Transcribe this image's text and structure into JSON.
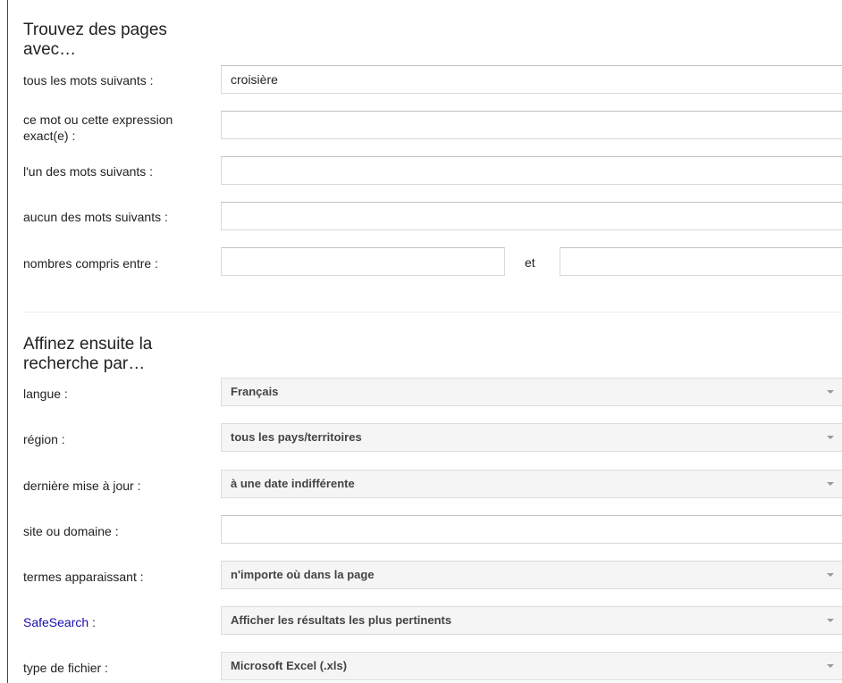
{
  "section1": {
    "heading": "Trouvez des pages avec…",
    "rows": [
      {
        "label": "tous les mots suivants :",
        "value": "croisière"
      },
      {
        "label": "ce mot ou cette expression exact(e) :",
        "value": ""
      },
      {
        "label": "l'un des mots suivants :",
        "value": ""
      },
      {
        "label": "aucun des mots suivants :",
        "value": ""
      },
      {
        "label": "nombres compris entre :",
        "value_from": "",
        "value_to": "",
        "separator": "et"
      }
    ]
  },
  "section2": {
    "heading": "Affinez ensuite la recherche par…",
    "rows": [
      {
        "label": "langue :",
        "value": "Français"
      },
      {
        "label": "région :",
        "value": "tous les pays/territoires"
      },
      {
        "label": "dernière mise à jour :",
        "value": "à une date indifférente"
      },
      {
        "label": "site ou domaine :",
        "value": ""
      },
      {
        "label": "termes apparaissant :",
        "value": "n'importe où dans la page"
      },
      {
        "label": "SafeSearch",
        "label_suffix": " :",
        "value": "Afficher les résultats les plus pertinents"
      },
      {
        "label": "type de fichier :",
        "value": "Microsoft Excel (.xls)"
      }
    ]
  },
  "colors": {
    "link": "#1a0dab",
    "text": "#222222",
    "select_bg": "#f5f5f5",
    "border": "#d9d9d9"
  },
  "icons": {
    "dropdown": "triangle-down-icon"
  }
}
